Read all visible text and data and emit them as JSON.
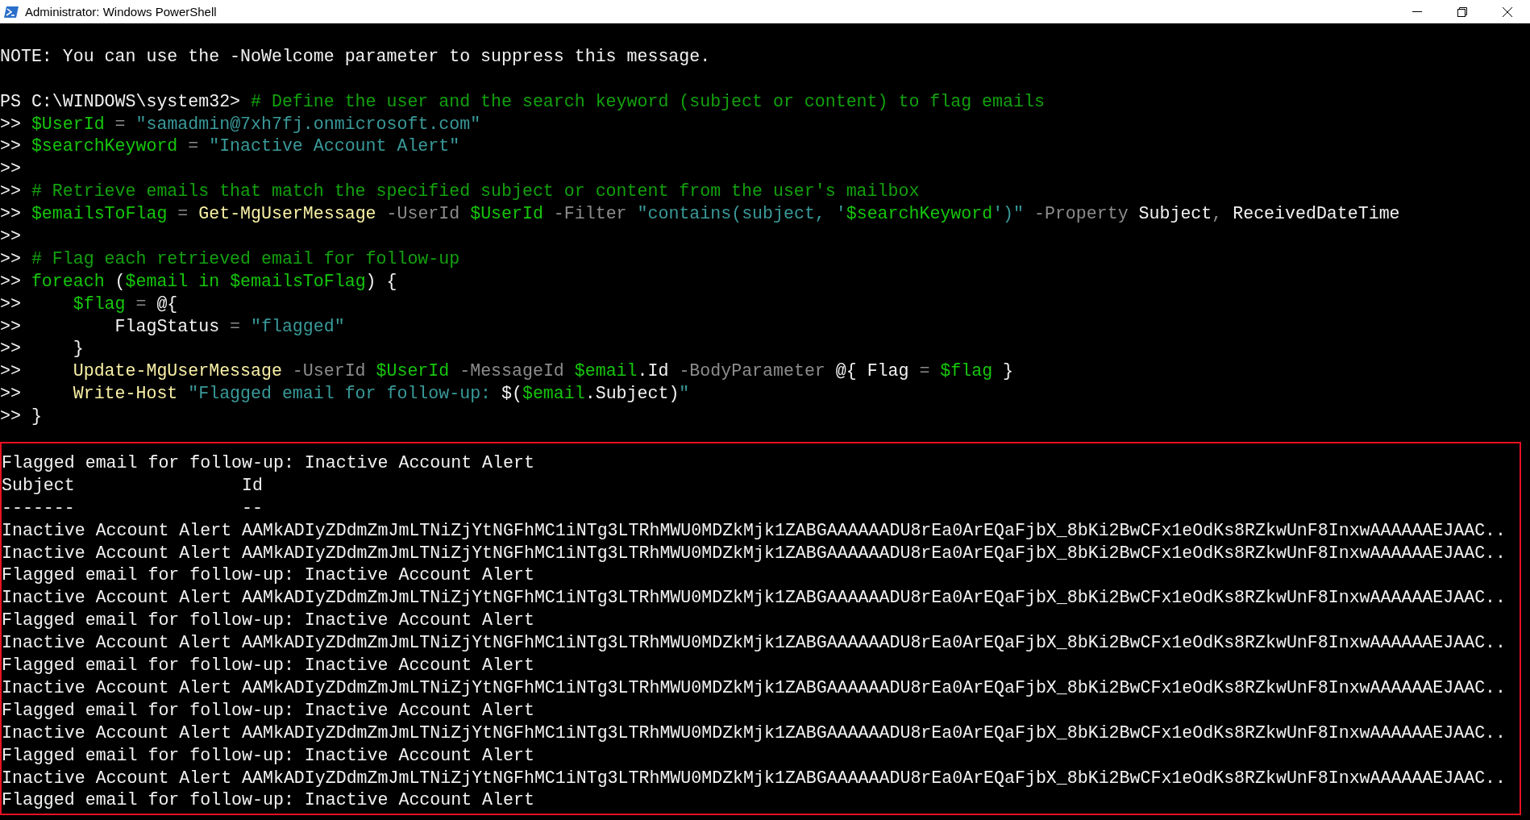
{
  "window": {
    "title": "Administrator: Windows PowerShell"
  },
  "console": {
    "lines": [
      {
        "kind": "blank"
      },
      {
        "kind": "text",
        "segments": [
          {
            "kind": "plain",
            "text": "NOTE: You can use the -NoWelcome parameter to suppress this message."
          }
        ]
      },
      {
        "kind": "blank"
      },
      {
        "kind": "text",
        "segments": [
          {
            "kind": "plain",
            "text": "PS C:\\WINDOWS\\system32> "
          },
          {
            "kind": "comment",
            "text": "# Define the user and the search keyword (subject or content) to flag emails"
          }
        ]
      },
      {
        "kind": "text",
        "segments": [
          {
            "kind": "plain",
            "text": ">> "
          },
          {
            "kind": "variable",
            "text": "$UserId"
          },
          {
            "kind": "operator",
            "text": " = "
          },
          {
            "kind": "string",
            "text": "\"samadmin@7xh7fj.onmicrosoft.com\""
          }
        ]
      },
      {
        "kind": "text",
        "segments": [
          {
            "kind": "plain",
            "text": ">> "
          },
          {
            "kind": "variable",
            "text": "$searchKeyword"
          },
          {
            "kind": "operator",
            "text": " = "
          },
          {
            "kind": "string",
            "text": "\"Inactive Account Alert\""
          }
        ]
      },
      {
        "kind": "text",
        "segments": [
          {
            "kind": "plain",
            "text": ">>"
          }
        ]
      },
      {
        "kind": "text",
        "segments": [
          {
            "kind": "plain",
            "text": ">> "
          },
          {
            "kind": "comment",
            "text": "# Retrieve emails that match the specified subject or content from the user's mailbox"
          }
        ]
      },
      {
        "kind": "text",
        "segments": [
          {
            "kind": "plain",
            "text": ">> "
          },
          {
            "kind": "variable",
            "text": "$emailsToFlag"
          },
          {
            "kind": "operator",
            "text": " = "
          },
          {
            "kind": "command",
            "text": "Get-MgUserMessage"
          },
          {
            "kind": "parameter",
            "text": " -UserId "
          },
          {
            "kind": "variable",
            "text": "$UserId"
          },
          {
            "kind": "parameter",
            "text": " -Filter "
          },
          {
            "kind": "string",
            "text": "\"contains(subject, '"
          },
          {
            "kind": "variable",
            "text": "$searchKeyword"
          },
          {
            "kind": "string",
            "text": "')\""
          },
          {
            "kind": "parameter",
            "text": " -Property "
          },
          {
            "kind": "plain",
            "text": "Subject"
          },
          {
            "kind": "operator",
            "text": ", "
          },
          {
            "kind": "plain",
            "text": "ReceivedDateTime"
          }
        ]
      },
      {
        "kind": "text",
        "segments": [
          {
            "kind": "plain",
            "text": ">>"
          }
        ]
      },
      {
        "kind": "text",
        "segments": [
          {
            "kind": "plain",
            "text": ">> "
          },
          {
            "kind": "comment",
            "text": "# Flag each retrieved email for follow-up"
          }
        ]
      },
      {
        "kind": "text",
        "segments": [
          {
            "kind": "plain",
            "text": ">> "
          },
          {
            "kind": "keyword",
            "text": "foreach"
          },
          {
            "kind": "plain",
            "text": " ("
          },
          {
            "kind": "variable",
            "text": "$email"
          },
          {
            "kind": "keyword",
            "text": " in "
          },
          {
            "kind": "variable",
            "text": "$emailsToFlag"
          },
          {
            "kind": "plain",
            "text": ") {"
          }
        ]
      },
      {
        "kind": "text",
        "segments": [
          {
            "kind": "plain",
            "text": ">>     "
          },
          {
            "kind": "variable",
            "text": "$flag"
          },
          {
            "kind": "operator",
            "text": " = "
          },
          {
            "kind": "plain",
            "text": "@{"
          }
        ]
      },
      {
        "kind": "text",
        "segments": [
          {
            "kind": "plain",
            "text": ">>         FlagStatus"
          },
          {
            "kind": "operator",
            "text": " = "
          },
          {
            "kind": "string",
            "text": "\"flagged\""
          }
        ]
      },
      {
        "kind": "text",
        "segments": [
          {
            "kind": "plain",
            "text": ">>     }"
          }
        ]
      },
      {
        "kind": "text",
        "segments": [
          {
            "kind": "plain",
            "text": ">>     "
          },
          {
            "kind": "command",
            "text": "Update-MgUserMessage"
          },
          {
            "kind": "parameter",
            "text": " -UserId "
          },
          {
            "kind": "variable",
            "text": "$UserId"
          },
          {
            "kind": "parameter",
            "text": " -MessageId "
          },
          {
            "kind": "variable",
            "text": "$email"
          },
          {
            "kind": "plain",
            "text": ".Id"
          },
          {
            "kind": "parameter",
            "text": " -BodyParameter "
          },
          {
            "kind": "plain",
            "text": "@{ Flag "
          },
          {
            "kind": "operator",
            "text": "= "
          },
          {
            "kind": "variable",
            "text": "$flag"
          },
          {
            "kind": "plain",
            "text": " }"
          }
        ]
      },
      {
        "kind": "text",
        "segments": [
          {
            "kind": "plain",
            "text": ">>     "
          },
          {
            "kind": "command",
            "text": "Write-Host"
          },
          {
            "kind": "string",
            "text": " \"Flagged email for follow-up: "
          },
          {
            "kind": "plain",
            "text": "$("
          },
          {
            "kind": "variable",
            "text": "$email"
          },
          {
            "kind": "plain",
            "text": ".Subject)"
          },
          {
            "kind": "string",
            "text": "\""
          }
        ]
      },
      {
        "kind": "text",
        "segments": [
          {
            "kind": "plain",
            "text": ">> }"
          }
        ]
      }
    ],
    "output": [
      "Flagged email for follow-up: Inactive Account Alert",
      "Subject                Id",
      "-------                --",
      "Inactive Account Alert AAMkADIyZDdmZmJmLTNiZjYtNGFhMC1iNTg3LTRhMWU0MDZkMjk1ZABGAAAAAADU8rEa0ArEQaFjbX_8bKi2BwCFx1eOdKs8RZkwUnF8InxwAAAAAAEJAAC..",
      "Inactive Account Alert AAMkADIyZDdmZmJmLTNiZjYtNGFhMC1iNTg3LTRhMWU0MDZkMjk1ZABGAAAAAADU8rEa0ArEQaFjbX_8bKi2BwCFx1eOdKs8RZkwUnF8InxwAAAAAAEJAAC..",
      "Flagged email for follow-up: Inactive Account Alert",
      "Inactive Account Alert AAMkADIyZDdmZmJmLTNiZjYtNGFhMC1iNTg3LTRhMWU0MDZkMjk1ZABGAAAAAADU8rEa0ArEQaFjbX_8bKi2BwCFx1eOdKs8RZkwUnF8InxwAAAAAAEJAAC..",
      "Flagged email for follow-up: Inactive Account Alert",
      "Inactive Account Alert AAMkADIyZDdmZmJmLTNiZjYtNGFhMC1iNTg3LTRhMWU0MDZkMjk1ZABGAAAAAADU8rEa0ArEQaFjbX_8bKi2BwCFx1eOdKs8RZkwUnF8InxwAAAAAAEJAAC..",
      "Flagged email for follow-up: Inactive Account Alert",
      "Inactive Account Alert AAMkADIyZDdmZmJmLTNiZjYtNGFhMC1iNTg3LTRhMWU0MDZkMjk1ZABGAAAAAADU8rEa0ArEQaFjbX_8bKi2BwCFx1eOdKs8RZkwUnF8InxwAAAAAAEJAAC..",
      "Flagged email for follow-up: Inactive Account Alert",
      "Inactive Account Alert AAMkADIyZDdmZmJmLTNiZjYtNGFhMC1iNTg3LTRhMWU0MDZkMjk1ZABGAAAAAADU8rEa0ArEQaFjbX_8bKi2BwCFx1eOdKs8RZkwUnF8InxwAAAAAAEJAAC..",
      "Flagged email for follow-up: Inactive Account Alert",
      "Inactive Account Alert AAMkADIyZDdmZmJmLTNiZjYtNGFhMC1iNTg3LTRhMWU0MDZkMjk1ZABGAAAAAADU8rEa0ArEQaFjbX_8bKi2BwCFx1eOdKs8RZkwUnF8InxwAAAAAAEJAAC..",
      "Flagged email for follow-up: Inactive Account Alert"
    ]
  }
}
